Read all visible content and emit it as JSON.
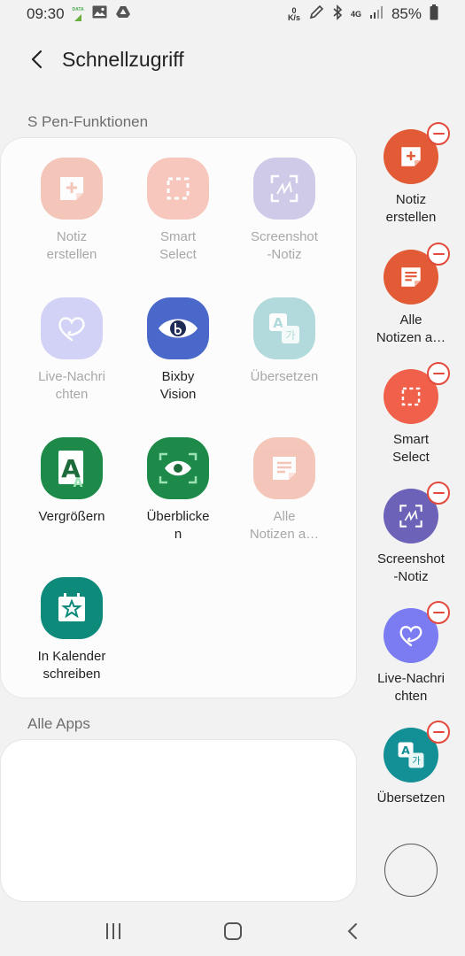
{
  "status_bar": {
    "time": "09:30",
    "data_label": "DATA",
    "speed_value": "0",
    "speed_unit": "K/s",
    "network": "4G",
    "battery": "85%"
  },
  "header": {
    "title": "Schnellzugriff",
    "back_icon": "chevron-left-icon"
  },
  "sections": {
    "features_title": "S Pen-Funktionen",
    "all_apps_title": "Alle Apps"
  },
  "features": [
    {
      "label": "Notiz\nerstellen",
      "icon": "create-note-icon",
      "color": "#e8613e",
      "enabled": false
    },
    {
      "label": "Smart\nSelect",
      "icon": "smart-select-icon",
      "color": "#f0684a",
      "enabled": false
    },
    {
      "label": "Screenshot\n-Notiz",
      "icon": "screenshot-write-icon",
      "color": "#7a6fc4",
      "enabled": false
    },
    {
      "label": "Live-Nachri\nchten",
      "icon": "live-message-icon",
      "color": "#8686f0",
      "enabled": false
    },
    {
      "label": "Bixby\nVision",
      "icon": "bixby-vision-icon",
      "color": "#4a68c9",
      "enabled": true
    },
    {
      "label": "Übersetzen",
      "icon": "translate-icon",
      "color": "#2b9aa0",
      "enabled": false
    },
    {
      "label": "Vergrößern",
      "icon": "magnify-icon",
      "color": "#1d8a4a",
      "enabled": true
    },
    {
      "label": "Überblicke\nn",
      "icon": "glance-icon",
      "color": "#1d8a4a",
      "enabled": true
    },
    {
      "label": "Alle\nNotizen a…",
      "icon": "view-all-notes-icon",
      "color": "#e8613e",
      "enabled": false
    },
    {
      "label": "In Kalender\nschreiben",
      "icon": "write-on-calendar-icon",
      "color": "#0e8a7a",
      "enabled": true
    }
  ],
  "shortcuts": [
    {
      "label": "Notiz\nerstellen",
      "icon": "create-note-icon",
      "color": "#e35a36"
    },
    {
      "label": "Alle\nNotizen a…",
      "icon": "view-all-notes-icon",
      "color": "#e35a36"
    },
    {
      "label": "Smart\nSelect",
      "icon": "smart-select-icon",
      "color": "#f0604a"
    },
    {
      "label": "Screenshot\n-Notiz",
      "icon": "screenshot-write-icon",
      "color": "#6c63b8"
    },
    {
      "label": "Live-Nachri\nchten",
      "icon": "live-message-icon",
      "color": "#7b7cf2"
    },
    {
      "label": "Übersetzen",
      "icon": "translate-icon",
      "color": "#138f96"
    }
  ],
  "nav": {
    "recents_icon": "recents-icon",
    "home_icon": "home-icon",
    "back_icon": "back-icon"
  }
}
